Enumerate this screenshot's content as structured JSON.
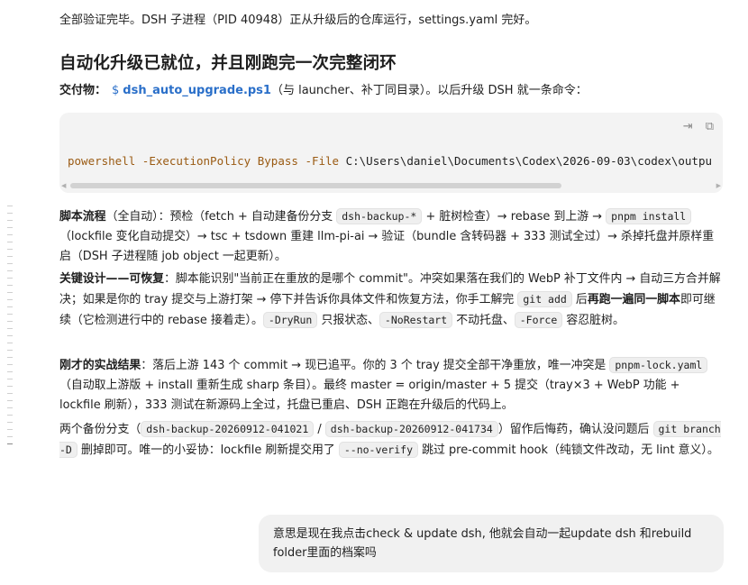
{
  "intro": "全部验证完毕。DSH 子进程（PID 40948）正从升级后的仓库运行，settings.yaml 完好。",
  "heading": "自动化升级已就位，并且刚跑完一次完整闭环",
  "deliverable": {
    "label": "交付物：",
    "dollar": "$",
    "file": "dsh_auto_upgrade.ps1",
    "rest": "（与 launcher、补丁同目录）。以后升级 DSH 就一条命令："
  },
  "code": {
    "copy_icon": "copy-icon",
    "wrap_icon": "wrap-icon",
    "cmd": "powershell",
    "flag1": "-ExecutionPolicy",
    "val1": "Bypass",
    "flag2": "-File",
    "path": "C:\\Users\\daniel\\Documents\\Codex\\2026-09-03\\codex\\outpu"
  },
  "p1": {
    "b1": "脚本流程",
    "t1": "（全自动）：预检（fetch + 自动建备份分支 ",
    "c1": "dsh-backup-*",
    "t2": " + 脏树检查）→ rebase 到上游 → ",
    "c2": "pnpm install",
    "t3": "（lockfile 变化自动提交）→ tsc + tsdown 重建 llm-pi-ai → 验证（bundle 含转码器 + 333 测试全过）→ 杀掉托盘并原样重启（DSH 子进程随 job object 一起更新）。"
  },
  "p2": {
    "b1": "关键设计——可恢复",
    "t1": "：脚本能识别\"当前正在重放的是哪个 commit\"。冲突如果落在我们的 WebP 补丁文件内 → 自动三方合并解决；如果是你的 tray 提交与上游打架 → 停下并告诉你具体文件和恢复方法，你手工解完 ",
    "c1": "git add",
    "t2": " 后",
    "b2": "再跑一遍同一脚本",
    "t3": "即可继续（它检测进行中的 rebase 接着走）。",
    "c2": "-DryRun",
    "t4": " 只报状态、",
    "c3": "-NoRestart",
    "t5": " 不动托盘、",
    "c4": "-Force",
    "t6": " 容忍脏树。"
  },
  "p3": {
    "b1": "刚才的实战结果",
    "t1": "：落后上游 143 个 commit → 现已追平。你的 3 个 tray 提交全部干净重放，唯一冲突是 ",
    "c1": "pnpm-lock.yaml",
    "t2": "（自动取上游版 + install 重新生成 sharp 条目）。最终 master = origin/master + 5 提交（tray×3 + WebP 功能 + lockfile 刷新），333 测试在新源码上全过，托盘已重启、DSH 正跑在升级后的代码上。"
  },
  "p4": {
    "t1": "两个备份分支（",
    "c1": "dsh-backup-20260912-041021",
    "t2": " / ",
    "c2": "dsh-backup-20260912-041734",
    "t3": "）留作后悔药，确认没问题后 ",
    "c3": "git branch -D",
    "t4": " 删掉即可。唯一的小妥协：lockfile 刷新提交用了 ",
    "c4": "--no-verify",
    "t5": " 跳过 pre-commit hook（纯锁文件改动，无 lint 意义）。"
  },
  "user_message": "意思是现在我点击check & update dsh, 他就会自动一起update dsh 和rebuild folder里面的档案吗"
}
